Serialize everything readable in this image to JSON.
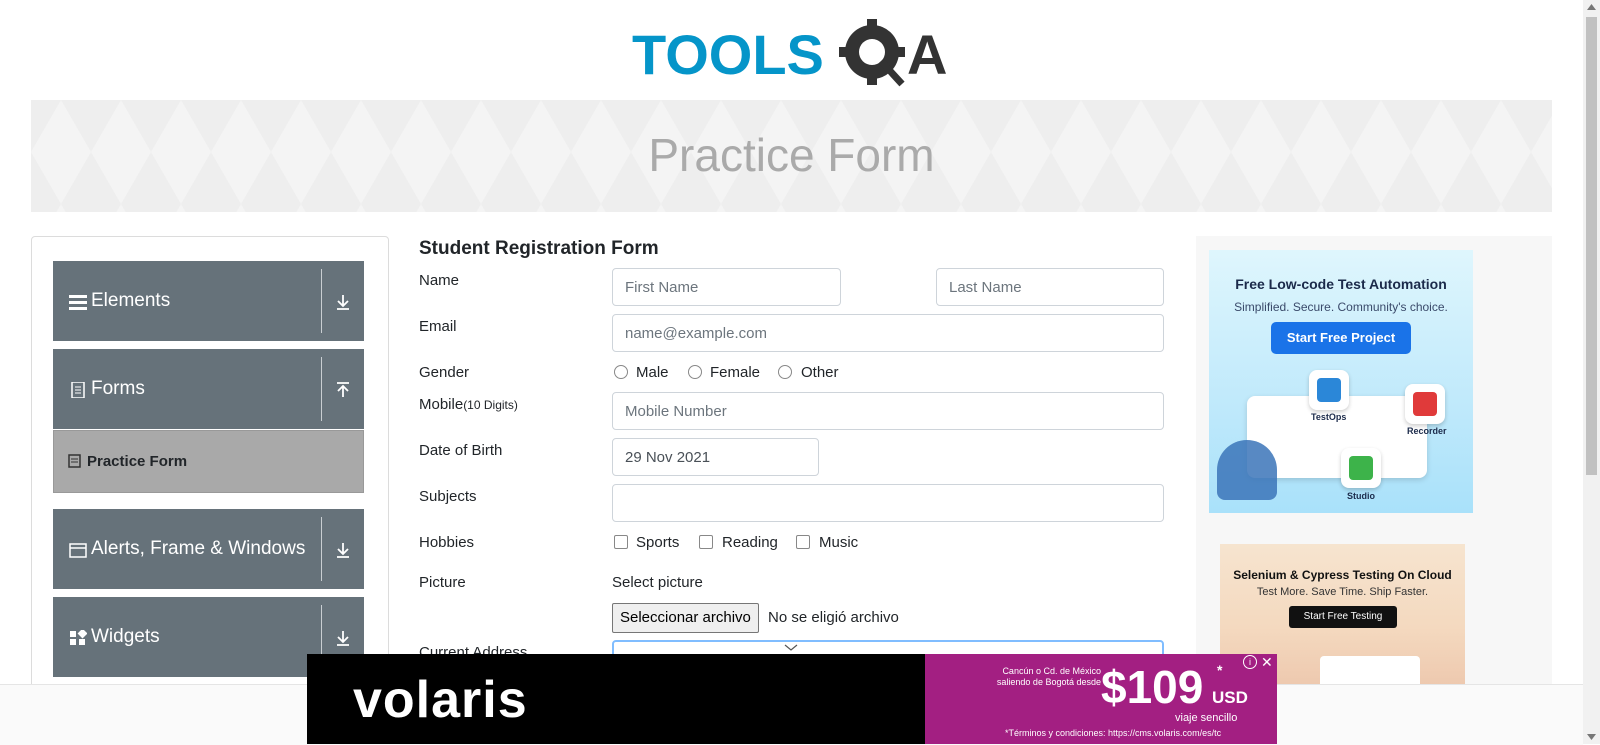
{
  "header": {
    "logo_text_left": "TOOLS",
    "logo_text_right": "A",
    "page_title": "Practice Form"
  },
  "sidebar": {
    "groups": [
      {
        "label": "Elements",
        "icon": "menu-icon",
        "toggle": "down"
      },
      {
        "label": "Forms",
        "icon": "document-icon",
        "toggle": "up"
      },
      {
        "label": "Alerts, Frame & Windows",
        "icon": "window-icon",
        "toggle": "down"
      },
      {
        "label": "Widgets",
        "icon": "widgets-icon",
        "toggle": "down"
      }
    ],
    "active_item": {
      "label": "Practice Form",
      "icon": "form-icon"
    }
  },
  "form": {
    "title": "Student Registration Form",
    "name_label": "Name",
    "first_name_placeholder": "First Name",
    "last_name_placeholder": "Last Name",
    "email_label": "Email",
    "email_placeholder": "name@example.com",
    "gender_label": "Gender",
    "gender_options": [
      "Male",
      "Female",
      "Other"
    ],
    "mobile_label": "Mobile",
    "mobile_hint": "(10 Digits)",
    "mobile_placeholder": "Mobile Number",
    "dob_label": "Date of Birth",
    "dob_value": "29 Nov 2021",
    "subjects_label": "Subjects",
    "hobbies_label": "Hobbies",
    "hobby_options": [
      "Sports",
      "Reading",
      "Music"
    ],
    "picture_label": "Picture",
    "select_picture": "Select picture",
    "file_button": "Seleccionar archivo",
    "file_status": "No se eligió archivo",
    "address_label": "Current Address"
  },
  "ads": {
    "ad1": {
      "title": "Free Low-code Test Automation",
      "subtitle": "Simplified. Secure. Community's choice.",
      "cta": "Start Free Project",
      "tags": [
        "TestOps",
        "Recorder",
        "Studio"
      ]
    },
    "ad2": {
      "title": "Selenium & Cypress Testing On Cloud",
      "subtitle": "Test More. Save Time. Ship Faster.",
      "cta": "Start Free Testing"
    },
    "bottom": {
      "brand": "volaris",
      "route": "Cancún o Cd. de México saliendo de Bogotá desde",
      "price": "$109",
      "currency": "USD",
      "asterisk": "*",
      "note": "viaje sencillo",
      "terms": "*Términos y condiciones: https://cms.volaris.com/es/tc"
    }
  },
  "colors": {
    "sidebar_group": "#66727a",
    "active_item": "#a9a9a9",
    "logo_blue": "#0595c9",
    "ad_cta_blue": "#1a73e8",
    "volaris_magenta": "#a31f82"
  }
}
